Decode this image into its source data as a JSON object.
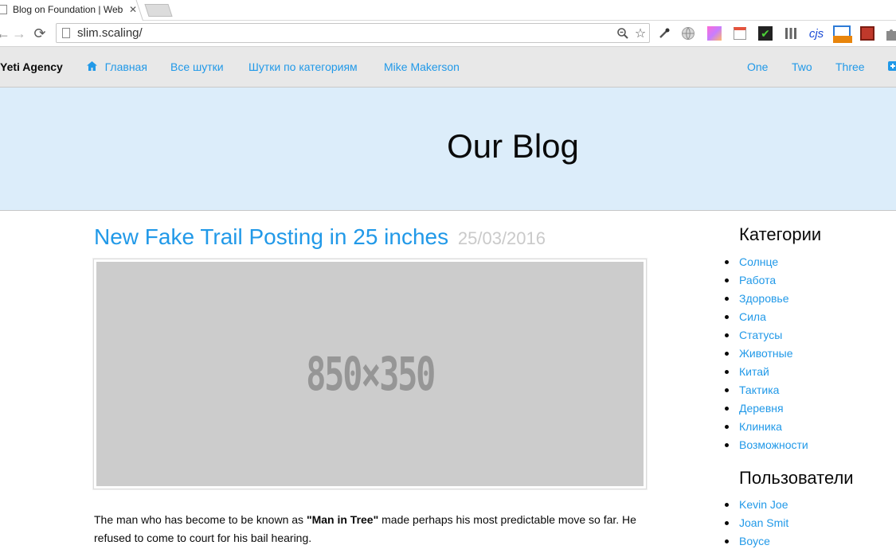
{
  "browser": {
    "tab_title": "Blog on Foundation | Web",
    "url": "slim.scaling/"
  },
  "topbar": {
    "brand": "Yeti Agency",
    "left_menu": [
      "Главная",
      "Все шутки",
      "Шутки по категориям",
      "Mike Makerson"
    ],
    "right_menu": [
      "One",
      "Two",
      "Three"
    ]
  },
  "hero": {
    "title": "Our Blog"
  },
  "post": {
    "title": "New Fake Trail Posting in 25 inches",
    "date": "25/03/2016",
    "image_label": "850×350",
    "body_before": "The man who has become to be known as ",
    "body_bold": "\"Man in Tree\"",
    "body_after": " made perhaps his most predictable move so far. He refused to come to court for his bail hearing."
  },
  "sidebar": {
    "categories_heading": "Категории",
    "categories": [
      "Солнце",
      "Работа",
      "Здоровье",
      "Сила",
      "Статусы",
      "Животные",
      "Китай",
      "Тактика",
      "Деревня",
      "Клиника",
      "Возможности"
    ],
    "users_heading": "Пользователи",
    "users": [
      "Kevin Joe",
      "Joan Smit",
      "Boyce"
    ]
  },
  "colors": {
    "link": "#2199e8",
    "hero_bg": "#dcedfa",
    "topbar_bg": "#e8e8e8"
  },
  "icons": [
    "back-arrow-icon",
    "forward-arrow-icon",
    "reload-icon",
    "page-icon",
    "zoom-icon",
    "star-icon",
    "home-icon"
  ]
}
